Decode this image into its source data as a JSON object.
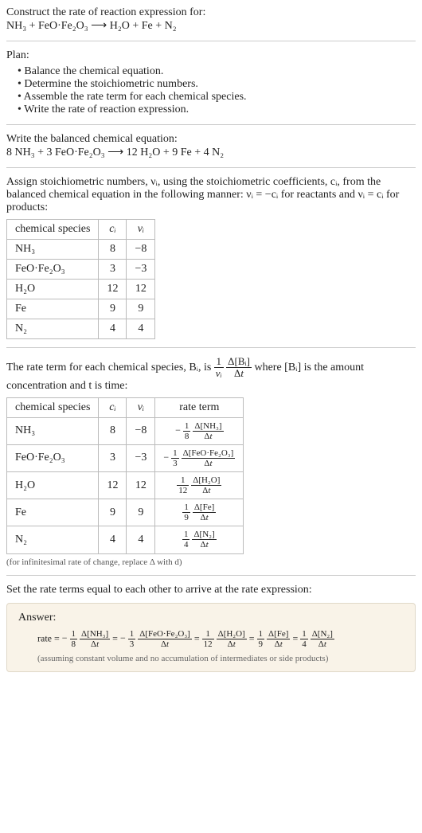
{
  "header": {
    "construct": "Construct the rate of reaction expression for:",
    "reaction": "NH₃ + FeO·Fe₂O₃  ⟶  H₂O + Fe + N₂"
  },
  "plan": {
    "title": "Plan:",
    "items": [
      "Balance the chemical equation.",
      "Determine the stoichiometric numbers.",
      "Assemble the rate term for each chemical species.",
      "Write the rate of reaction expression."
    ]
  },
  "balanced": {
    "title": "Write the balanced chemical equation:",
    "equation": "8 NH₃ + 3 FeO·Fe₂O₃  ⟶  12 H₂O + 9 Fe + 4 N₂"
  },
  "assign": {
    "intro": "Assign stoichiometric numbers, νᵢ, using the stoichiometric coefficients, cᵢ, from the balanced chemical equation in the following manner: νᵢ = −cᵢ for reactants and νᵢ = cᵢ for products:",
    "cols": [
      "chemical species",
      "cᵢ",
      "νᵢ"
    ],
    "rows": [
      {
        "species": "NH₃",
        "c": "8",
        "v": "−8"
      },
      {
        "species": "FeO·Fe₂O₃",
        "c": "3",
        "v": "−3"
      },
      {
        "species": "H₂O",
        "c": "12",
        "v": "12"
      },
      {
        "species": "Fe",
        "c": "9",
        "v": "9"
      },
      {
        "species": "N₂",
        "c": "4",
        "v": "4"
      }
    ]
  },
  "rateterm": {
    "intro1": "The rate term for each chemical species, Bᵢ, is ",
    "intro2": " where [Bᵢ] is the amount concentration and t is time:",
    "cols": [
      "chemical species",
      "cᵢ",
      "νᵢ",
      "rate term"
    ],
    "rows": [
      {
        "species": "NH₃",
        "c": "8",
        "v": "−8",
        "sign": "−",
        "den": "8",
        "dnum": "Δ[NH₃]"
      },
      {
        "species": "FeO·Fe₂O₃",
        "c": "3",
        "v": "−3",
        "sign": "−",
        "den": "3",
        "dnum": "Δ[FeO·Fe₂O₃]"
      },
      {
        "species": "H₂O",
        "c": "12",
        "v": "12",
        "sign": "",
        "den": "12",
        "dnum": "Δ[H₂O]"
      },
      {
        "species": "Fe",
        "c": "9",
        "v": "9",
        "sign": "",
        "den": "9",
        "dnum": "Δ[Fe]"
      },
      {
        "species": "N₂",
        "c": "4",
        "v": "4",
        "sign": "",
        "den": "4",
        "dnum": "Δ[N₂]"
      }
    ],
    "note": "(for infinitesimal rate of change, replace Δ with d)"
  },
  "final": {
    "intro": "Set the rate terms equal to each other to arrive at the rate expression:",
    "answer_label": "Answer:",
    "prefix": "rate = ",
    "terms": [
      {
        "sign": "−",
        "den": "8",
        "dnum": "Δ[NH₃]"
      },
      {
        "sign": "−",
        "den": "3",
        "dnum": "Δ[FeO·Fe₂O₃]"
      },
      {
        "sign": "",
        "den": "12",
        "dnum": "Δ[H₂O]"
      },
      {
        "sign": "",
        "den": "9",
        "dnum": "Δ[Fe]"
      },
      {
        "sign": "",
        "den": "4",
        "dnum": "Δ[N₂]"
      }
    ],
    "note": "(assuming constant volume and no accumulation of intermediates or side products)"
  },
  "chart_data": {
    "type": "table",
    "title": "Stoichiometric numbers and rate terms for reaction 8 NH3 + 3 FeO·Fe2O3 -> 12 H2O + 9 Fe + 4 N2",
    "columns": [
      "species",
      "c_i",
      "v_i",
      "rate_term"
    ],
    "rows": [
      [
        "NH3",
        8,
        -8,
        "-(1/8) d[NH3]/dt"
      ],
      [
        "FeO·Fe2O3",
        3,
        -3,
        "-(1/3) d[FeO·Fe2O3]/dt"
      ],
      [
        "H2O",
        12,
        12,
        "(1/12) d[H2O]/dt"
      ],
      [
        "Fe",
        9,
        9,
        "(1/9) d[Fe]/dt"
      ],
      [
        "N2",
        4,
        4,
        "(1/4) d[N2]/dt"
      ]
    ]
  }
}
